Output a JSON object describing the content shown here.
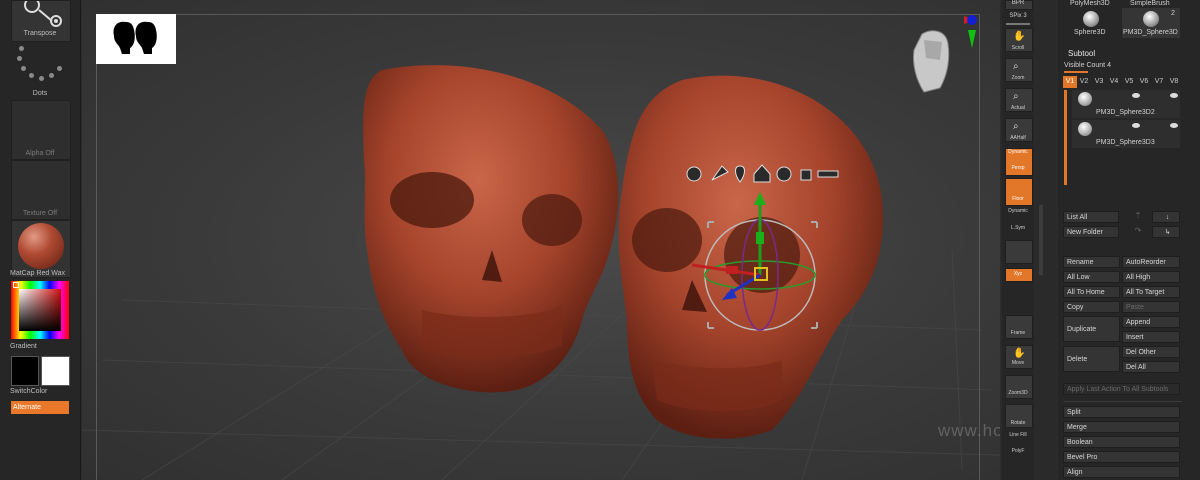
{
  "left_shelf": {
    "transpose_label": "Transpose",
    "dots_label": "Dots",
    "alpha_label": "Alpha Off",
    "texture_label": "Texture Off",
    "matcap_label": "MatCap Red Wax",
    "gradient_label": "Gradient",
    "switch_color_label": "SwitchColor",
    "alternate_label": "Alternate"
  },
  "right_toolbar": {
    "bpr_label": "BPR",
    "spix_label": "SPix 3",
    "scroll_label": "Scroll",
    "zoom_label": "Zoom",
    "actual_label": "Actual",
    "aahalf_label": "AAHalf",
    "dynamic_label": "Dynamic",
    "persp_label": "Persp",
    "floor_label": "Floor",
    "dynamic2_label": "Dynamic",
    "lsym_label": "L.Sym",
    "xyz_label": "Xyz",
    "frame_label": "Frame",
    "move_label": "Move",
    "zoom3d_label": "Zoom3D",
    "rotate_label": "Rotate",
    "linefill_label": "Line Fill",
    "polyf_label": "PolyF"
  },
  "tool_palette": {
    "polymesh_label": "PolyMesh3D",
    "simplebrush_label": "SimpleBrush",
    "sphere_label": "Sphere3D",
    "pm3d_label": "PM3D_Sphere3D",
    "count_label": "2"
  },
  "subtool": {
    "title": "Subtool",
    "visible_count": "Visible Count 4",
    "tabs": [
      "V1",
      "V2",
      "V3",
      "V4",
      "V5",
      "V6",
      "V7",
      "V8"
    ],
    "items": [
      {
        "name": "PM3D_Sphere3D2"
      },
      {
        "name": "PM3D_Sphere3D3"
      }
    ],
    "list_all": "List All",
    "new_folder": "New Folder",
    "buttons": [
      [
        "Rename",
        "AutoReorder"
      ],
      [
        "All Low",
        "All High"
      ],
      [
        "All To Home",
        "All To Target"
      ],
      [
        "Copy",
        "Paste"
      ]
    ],
    "duplicate": "Duplicate",
    "append": "Append",
    "insert": "Insert",
    "delete": "Delete",
    "del_other": "Del Other",
    "del_all": "Del All",
    "apply_last": "Apply Last Action To All Subtools",
    "split": "Split",
    "merge": "Merge",
    "boolean": "Boolean",
    "bevel_pro": "Bevel Pro",
    "align": "Align"
  },
  "watermark": "www.hooparamz.com",
  "colors": {
    "accent": "#e2772a",
    "skull": "#b14a33",
    "background": "#3a3a3a"
  }
}
